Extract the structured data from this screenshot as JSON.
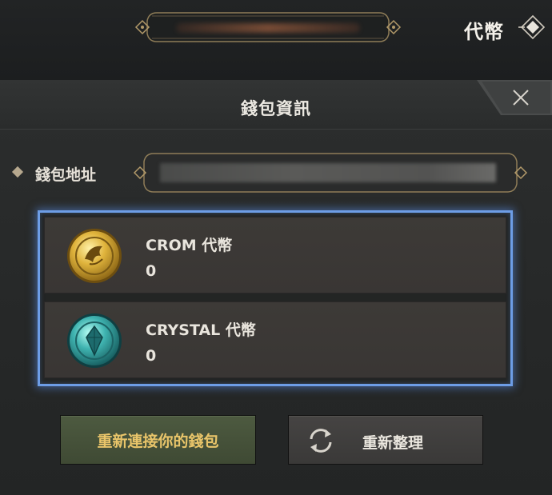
{
  "topbar": {
    "token_label": "代幣"
  },
  "dialog": {
    "title": "錢包資訊",
    "address_label": "錢包地址",
    "address_value": ""
  },
  "tokens": [
    {
      "name": "CROM 代幣",
      "amount": "0",
      "icon": "crom-coin-icon"
    },
    {
      "name": "CRYSTAL 代幣",
      "amount": "0",
      "icon": "crystal-coin-icon"
    }
  ],
  "buttons": {
    "reconnect_label": "重新連接你的錢包",
    "refresh_label": "重新整理"
  },
  "colors": {
    "selection_border": "#6d9de6",
    "reconnect_bg": "#4d5a40",
    "reconnect_text": "#e9c56a",
    "frame_gold": "#b39a6a"
  }
}
